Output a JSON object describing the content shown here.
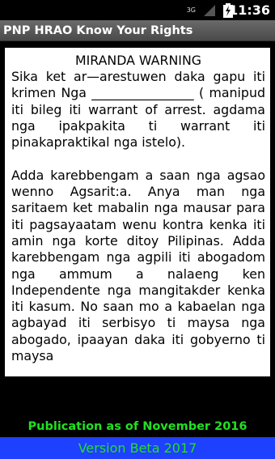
{
  "status_bar": {
    "network_label": "3G",
    "time": "11:36",
    "icons": [
      "signal-icon",
      "battery-charging-icon"
    ]
  },
  "app": {
    "title": "PNP HRAO Know Your Rights"
  },
  "document": {
    "heading": "MIRANDA WARNING",
    "paragraph_1": "Sika ket ar—arestuwen daka gapu iti krimen Nga ________________ ( manipud iti bileg iti warrant of arrest. agdama nga ipakpakita ti warrant iti pinakapraktikal nga istelo).",
    "paragraph_2": "Adda karebbengam a saan nga agsao wenno Agsarit:a. Anya man nga saritaem ket mabalin nga mausar para iti pagsayaatam wenu kontra kenka iti amin nga korte ditoy Pilipinas. Adda karebbengam nga agpili iti abogadom nga ammum a nalaeng ken Independente nga mangitakder kenka iti kasum. No saan mo a kabaelan nga agbayad iti serbisyo ti maysa nga abogado, ipaayan daka iti gobyerno ti maysa"
  },
  "footer": {
    "publication": "Publication as of November 2016",
    "version": "Version Beta 2017"
  },
  "colors": {
    "footer_text": "#22e022",
    "version_bar_bg": "#1e40ff",
    "title_bar_bg": "#5a5a5a"
  }
}
